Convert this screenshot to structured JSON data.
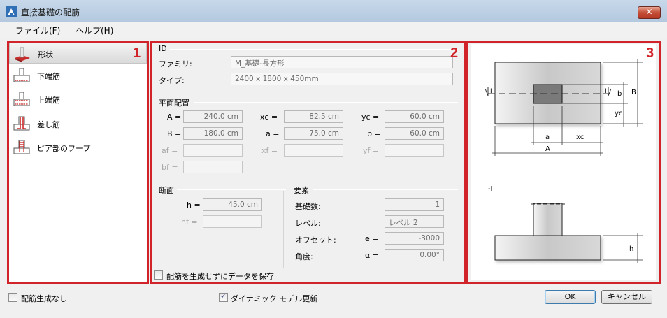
{
  "window": {
    "title": "直接基礎の配筋",
    "close_label": "✕"
  },
  "menu": [
    {
      "label": "ファイル(F)"
    },
    {
      "label": "ヘルプ(H)"
    }
  ],
  "section_numbers": [
    "1",
    "2",
    "3"
  ],
  "sidebar": {
    "items": [
      {
        "label": "形状",
        "icon": "footing-shape-icon",
        "selected": true
      },
      {
        "label": "下端筋",
        "icon": "bottom-rebar-icon",
        "selected": false
      },
      {
        "label": "上端筋",
        "icon": "top-rebar-icon",
        "selected": false
      },
      {
        "label": "差し筋",
        "icon": "dowel-rebar-icon",
        "selected": false
      },
      {
        "label": "ピア部のフープ",
        "icon": "pier-hoop-icon",
        "selected": false
      }
    ]
  },
  "id_group": {
    "title": "ID",
    "family_label": "ファミリ:",
    "family_value": "M_基礎-長方形",
    "type_label": "タイプ:",
    "type_value": "2400 x 1800 x 450mm"
  },
  "plan_group": {
    "title": "平面配置",
    "A_label": "A =",
    "A_value": "240.0 cm",
    "xc_label": "xc =",
    "xc_value": "82.5 cm",
    "yc_label": "yc =",
    "yc_value": "60.0 cm",
    "B_label": "B =",
    "B_value": "180.0 cm",
    "a_label": "a =",
    "a_value": "75.0 cm",
    "b_label": "b =",
    "b_value": "60.0 cm",
    "af_label": "af =",
    "xf_label": "xf =",
    "yf_label": "yf =",
    "bf_label": "bf ="
  },
  "section_group": {
    "title": "断面",
    "h_label": "h =",
    "h_value": "45.0 cm",
    "hf_label": "hf ="
  },
  "elements_group": {
    "title": "要素",
    "count_label": "基礎数:",
    "count_value": "1",
    "level_label": "レベル:",
    "level_value": "レベル 2",
    "offset_label": "オフセット:",
    "offset_var": "e =",
    "offset_value": "-3000",
    "angle_label": "角度:",
    "angle_var": "α =",
    "angle_value": "0.00°"
  },
  "save_without_rebar": {
    "label": "配筋を生成せずにデータを保存",
    "checked": false
  },
  "footer": {
    "no_rebar": {
      "label": "配筋生成なし",
      "checked": false
    },
    "dynamic_update": {
      "label": "ダイナミック モデル更新",
      "checked": true
    },
    "ok_label": "OK",
    "cancel_label": "キャンセル"
  },
  "diagram": {
    "section_label_I": "I",
    "section_title": "I-I",
    "dim_a": "a",
    "dim_xc": "xc",
    "dim_A": "A",
    "dim_b": "b",
    "dim_B": "B",
    "dim_yc": "yc",
    "dim_h": "h"
  },
  "colors": {
    "highlight_red": "#d1232a",
    "icon_red": "#cc2a2a"
  }
}
